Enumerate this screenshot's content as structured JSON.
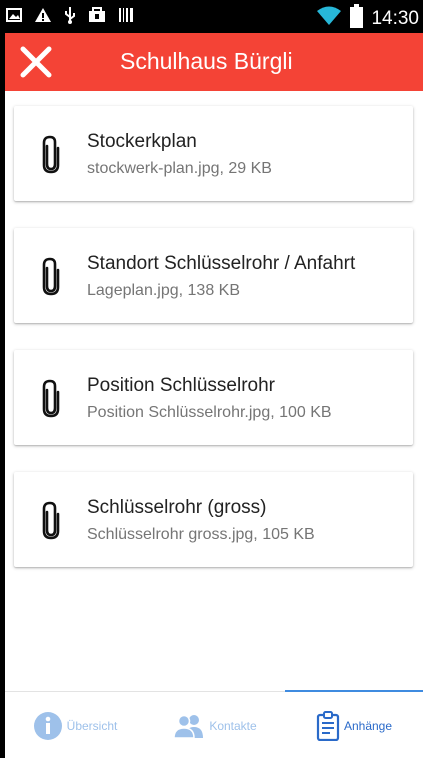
{
  "status_bar": {
    "time": "14:30",
    "left_icons": [
      "image-icon",
      "warning-icon",
      "usb-icon",
      "bag-icon",
      "barcode-icon"
    ],
    "right_icons": [
      "wifi-icon",
      "battery-icon"
    ]
  },
  "app_bar": {
    "close_icon": "close-icon",
    "title": "Schulhaus Bürgli",
    "color": "#f44336"
  },
  "attachments": [
    {
      "title": "Stockerkplan",
      "subtitle": "stockwerk-plan.jpg, 29 KB",
      "icon": "paperclip-icon"
    },
    {
      "title": "Standort Schlüsselrohr / Anfahrt",
      "subtitle": "Lageplan.jpg, 138 KB",
      "icon": "paperclip-icon"
    },
    {
      "title": "Position Schlüsselrohr",
      "subtitle": "Position Schlüsselrohr.jpg, 100 KB",
      "icon": "paperclip-icon"
    },
    {
      "title": "Schlüsselrohr (gross)",
      "subtitle": "Schlüsselrohr gross.jpg, 105 KB",
      "icon": "paperclip-icon"
    }
  ],
  "tabs": [
    {
      "label": "Übersicht",
      "icon": "info-icon",
      "active": false
    },
    {
      "label": "Kontakte",
      "icon": "contacts-icon",
      "active": false
    },
    {
      "label": "Anhänge",
      "icon": "clipboard-icon",
      "active": true
    }
  ],
  "colors": {
    "accent": "#f44336",
    "tab_active": "#2a6ac9",
    "tab_inactive": "#9ec1ea"
  }
}
